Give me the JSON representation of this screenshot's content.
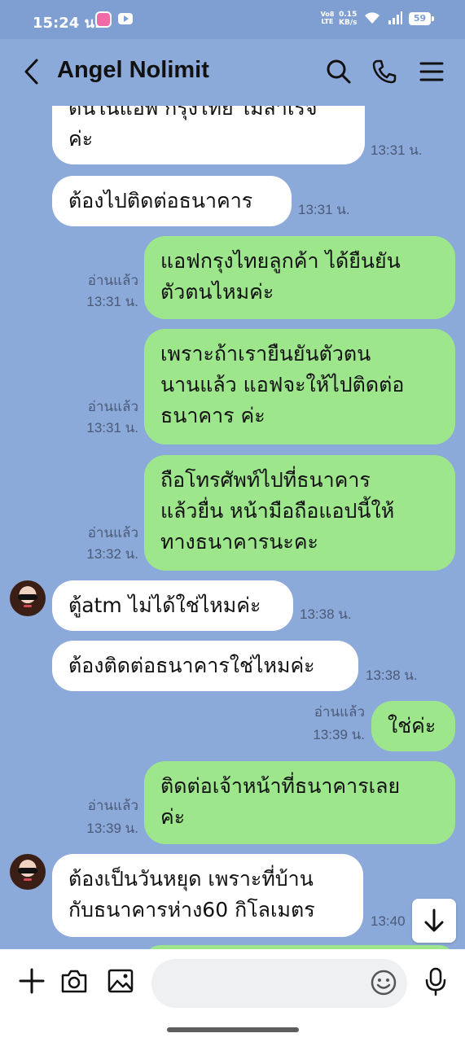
{
  "status_bar": {
    "time": "15:24 น.",
    "network_label": "Vo8 LTE",
    "speed_value": "0.15",
    "speed_unit": "KB/s",
    "battery": "59"
  },
  "header": {
    "title": "Angel Nolimit"
  },
  "messages": [
    {
      "side": "in",
      "text_line1": "ต้นในแอพ กรุงไทย ไม่สำเร็จ",
      "text_line2": "ค่ะ",
      "time": "13:31 น."
    },
    {
      "side": "in",
      "text": "ต้องไปติดต่อธนาคาร",
      "time": "13:31 น."
    },
    {
      "side": "out",
      "text_line1": "แอฟกรุงไทยลูกค้า ได้ยืนยัน",
      "text_line2": "ตัวตนไหมค่ะ",
      "read": "อ่านแล้ว",
      "time": "13:31 น."
    },
    {
      "side": "out",
      "text_line1": "เพราะถ้าเรายืนยันตัวตน",
      "text_line2": "นานแล้ว แอฟจะให้ไปติดต่อ",
      "text_line3": "ธนาคาร ค่ะ",
      "read": "อ่านแล้ว",
      "time": "13:31 น."
    },
    {
      "side": "out",
      "text_line1": "ถือโทรศัพท์ไปที่ธนาคาร",
      "text_line2": "แล้วยื่น หน้ามือถือแอปนี้ให้",
      "text_line3": "ทางธนาคารนะคะ",
      "read": "อ่านแล้ว",
      "time": "13:32 น."
    },
    {
      "side": "in",
      "text": "ตู้atm ไม่ได้ใช่ไหมค่ะ",
      "time": "13:38 น."
    },
    {
      "side": "in",
      "text": "ต้องติดต่อธนาคารใช่ไหมค่ะ",
      "time": "13:38 น."
    },
    {
      "side": "out",
      "text": "ใช่ค่ะ",
      "read": "อ่านแล้ว",
      "time": "13:39 น."
    },
    {
      "side": "out",
      "text_line1": "ติดต่อเจ้าหน้าที่ธนาคารเลย",
      "text_line2": "ค่ะ",
      "read": "อ่านแล้ว",
      "time": "13:39 น."
    },
    {
      "side": "in",
      "text_line1": "ต้องเป็นวันหยุด เพราะที่บ้าน",
      "text_line2": "กับธนาคารห่าง60 กิโลเมตร",
      "time": "13:40"
    }
  ],
  "input": {
    "placeholder": ""
  },
  "colors": {
    "chat_background": "#8caad9",
    "outgoing_bubble": "#9de68c",
    "incoming_bubble": "#ffffff"
  }
}
